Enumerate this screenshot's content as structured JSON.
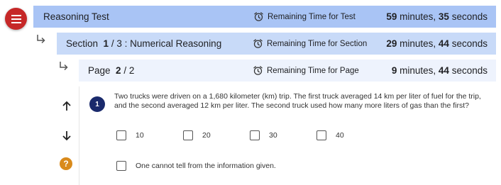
{
  "test": {
    "title": "Reasoning Test",
    "timer_label": "Remaining Time for Test",
    "minutes": "59",
    "minutes_unit": "minutes,",
    "seconds": "35",
    "seconds_unit": "seconds"
  },
  "section": {
    "label": "Section",
    "current": "1",
    "sep": "/",
    "total": "3",
    "name": ": Numerical Reasoning",
    "timer_label": "Remaining Time for Section",
    "minutes": "29",
    "minutes_unit": "minutes,",
    "seconds": "44",
    "seconds_unit": "seconds"
  },
  "page": {
    "label": "Page",
    "current": "2",
    "sep": "/",
    "total": "2",
    "timer_label": "Remaining Time for Page",
    "minutes": "9",
    "minutes_unit": "minutes,",
    "seconds": "44",
    "seconds_unit": "seconds"
  },
  "question": {
    "number": "1",
    "text": "Two trucks were driven on a 1,680 kilometer (km) trip. The first truck averaged 14 km per liter of fuel for the trip, and the second averaged 12 km per liter. The second truck used how many more liters of gas than the first?",
    "options": [
      "10",
      "20",
      "30",
      "40"
    ],
    "extra_option": "One cannot tell from the information given."
  },
  "icons": {
    "menu": "hamburger-menu-icon",
    "timer": "alarm-clock-icon",
    "return": "subdirectory-arrow-icon",
    "up": "arrow-up-icon",
    "down": "arrow-down-icon",
    "help": "help-icon"
  },
  "colors": {
    "menu_button": "#c62828",
    "test_bar": "#a9c4f5",
    "section_bar": "#c8daf8",
    "page_bar": "#eef3fd",
    "question_badge": "#1a2a6c",
    "help": "#d98a1b"
  }
}
